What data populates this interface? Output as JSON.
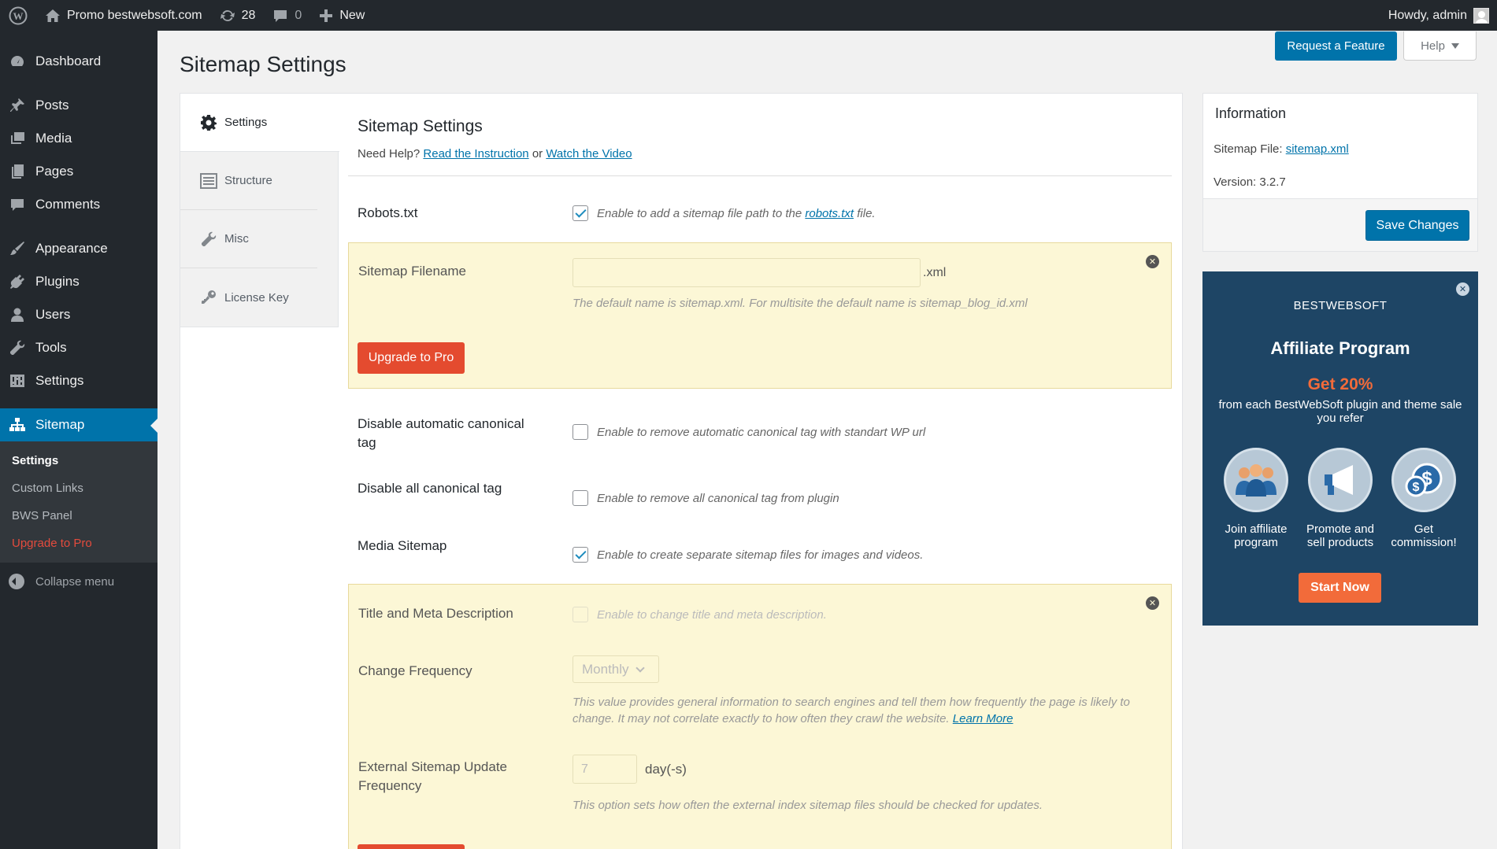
{
  "adminbar": {
    "site_name": "Promo bestwebsoft.com",
    "updates_count": "28",
    "comments_count": "0",
    "new_label": "New",
    "howdy": "Howdy, admin"
  },
  "sidebar": {
    "items": [
      {
        "label": "Dashboard",
        "icon": "dashboard-icon"
      },
      {
        "label": "Posts",
        "icon": "pin-icon"
      },
      {
        "label": "Media",
        "icon": "media-icon"
      },
      {
        "label": "Pages",
        "icon": "pages-icon"
      },
      {
        "label": "Comments",
        "icon": "comment-icon"
      },
      {
        "label": "Appearance",
        "icon": "brush-icon"
      },
      {
        "label": "Plugins",
        "icon": "plugin-icon"
      },
      {
        "label": "Users",
        "icon": "user-icon"
      },
      {
        "label": "Tools",
        "icon": "wrench-icon"
      },
      {
        "label": "Settings",
        "icon": "settings-icon"
      },
      {
        "label": "Sitemap",
        "icon": "sitemap-icon"
      }
    ],
    "submenu": [
      "Settings",
      "Custom Links",
      "BWS Panel",
      "Upgrade to Pro"
    ],
    "collapse": "Collapse menu"
  },
  "header": {
    "request_feature": "Request a Feature",
    "help": "Help",
    "page_title": "Sitemap Settings"
  },
  "tabs": [
    {
      "label": "Settings",
      "icon": "gear-icon"
    },
    {
      "label": "Structure",
      "icon": "list-icon"
    },
    {
      "label": "Misc",
      "icon": "wrench-icon"
    },
    {
      "label": "License Key",
      "icon": "key-icon"
    }
  ],
  "content": {
    "title": "Sitemap Settings",
    "need_help": "Need Help?",
    "read_instruction": "Read the Instruction",
    "or": "or",
    "watch_video": "Watch the Video",
    "robots": {
      "label": "Robots.txt",
      "text_before": "Enable to add a sitemap file path to the",
      "link": "robots.txt",
      "text_after": "file.",
      "checked": true
    },
    "filename": {
      "label": "Sitemap Filename",
      "value": "",
      "suffix": ".xml",
      "note": "The default name is sitemap.xml. For multisite the default name is sitemap_blog_id.xml",
      "upgrade": "Upgrade to Pro"
    },
    "canonical_auto": {
      "label": "Disable automatic canonical tag",
      "text": "Enable to remove automatic canonical tag with standart WP url",
      "checked": false
    },
    "canonical_all": {
      "label": "Disable all canonical tag",
      "text": "Enable to remove all canonical tag from plugin",
      "checked": false
    },
    "media": {
      "label": "Media Sitemap",
      "text": "Enable to create separate sitemap files for images and videos.",
      "checked": true
    },
    "meta": {
      "label": "Title and Meta Description",
      "text": "Enable to change title and meta description."
    },
    "frequency": {
      "label": "Change Frequency",
      "value": "Monthly",
      "note": "This value provides general information to search engines and tell them how frequently the page is likely to change. It may not correlate exactly to how often they crawl the website.",
      "learn_more": "Learn More"
    },
    "external": {
      "label": "External Sitemap Update Frequency",
      "value": "7",
      "unit": "day(-s)",
      "note": "This option sets how often the external index sitemap files should be checked for updates."
    }
  },
  "info": {
    "title": "Information",
    "file_label": "Sitemap File:",
    "file_link": "sitemap.xml",
    "version_label": "Version:",
    "version": "3.2.7",
    "save": "Save Changes"
  },
  "affiliate": {
    "brand": "BESTWEBSOFT",
    "title": "Affiliate Program",
    "get": "Get 20%",
    "from": "from each BestWebSoft plugin and theme sale you refer",
    "steps": [
      "Join affiliate program",
      "Promote and sell products",
      "Get commission!"
    ],
    "start": "Start Now"
  }
}
